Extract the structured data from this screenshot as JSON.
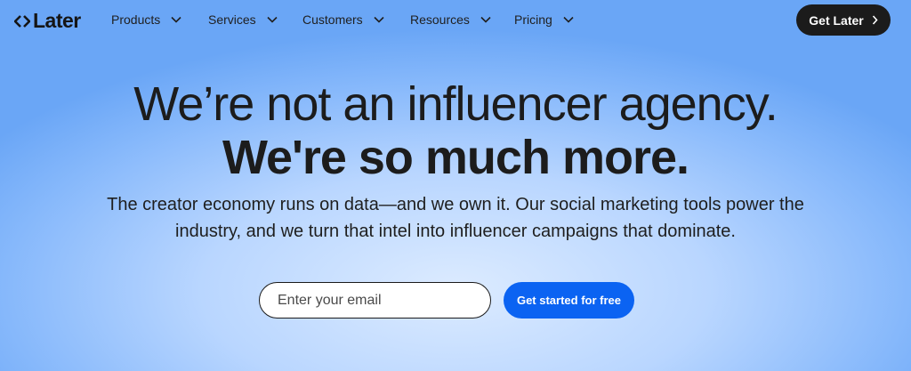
{
  "brand": {
    "logo_text": "Later",
    "logo_icon": "diamond-arrows-icon"
  },
  "nav": {
    "items": [
      {
        "label": "Products",
        "icon": "chevron-down-icon"
      },
      {
        "label": "Services",
        "icon": "chevron-down-icon"
      },
      {
        "label": "Customers",
        "icon": "chevron-down-icon"
      },
      {
        "label": "Resources",
        "icon": "chevron-down-icon"
      },
      {
        "label": "Pricing",
        "icon": "chevron-down-icon"
      }
    ],
    "cta_label": "Get Later",
    "cta_icon": "chevron-right-icon"
  },
  "hero": {
    "headline_light": "We’re not an influencer agency.",
    "headline_bold": "We're so much more.",
    "subtext_line1": "The creator economy runs on data—and we own it. Our social marketing tools power the",
    "subtext_line2": "industry, and we turn that intel into influencer campaigns that dominate."
  },
  "signup": {
    "email_placeholder": "Enter your email",
    "email_value": "",
    "button_label": "Get started for free"
  },
  "colors": {
    "primary_button": "#0b63f2",
    "dark_button": "#1b1b1b",
    "background_light": "#dcebff",
    "background_edge": "#6aa6f6"
  }
}
